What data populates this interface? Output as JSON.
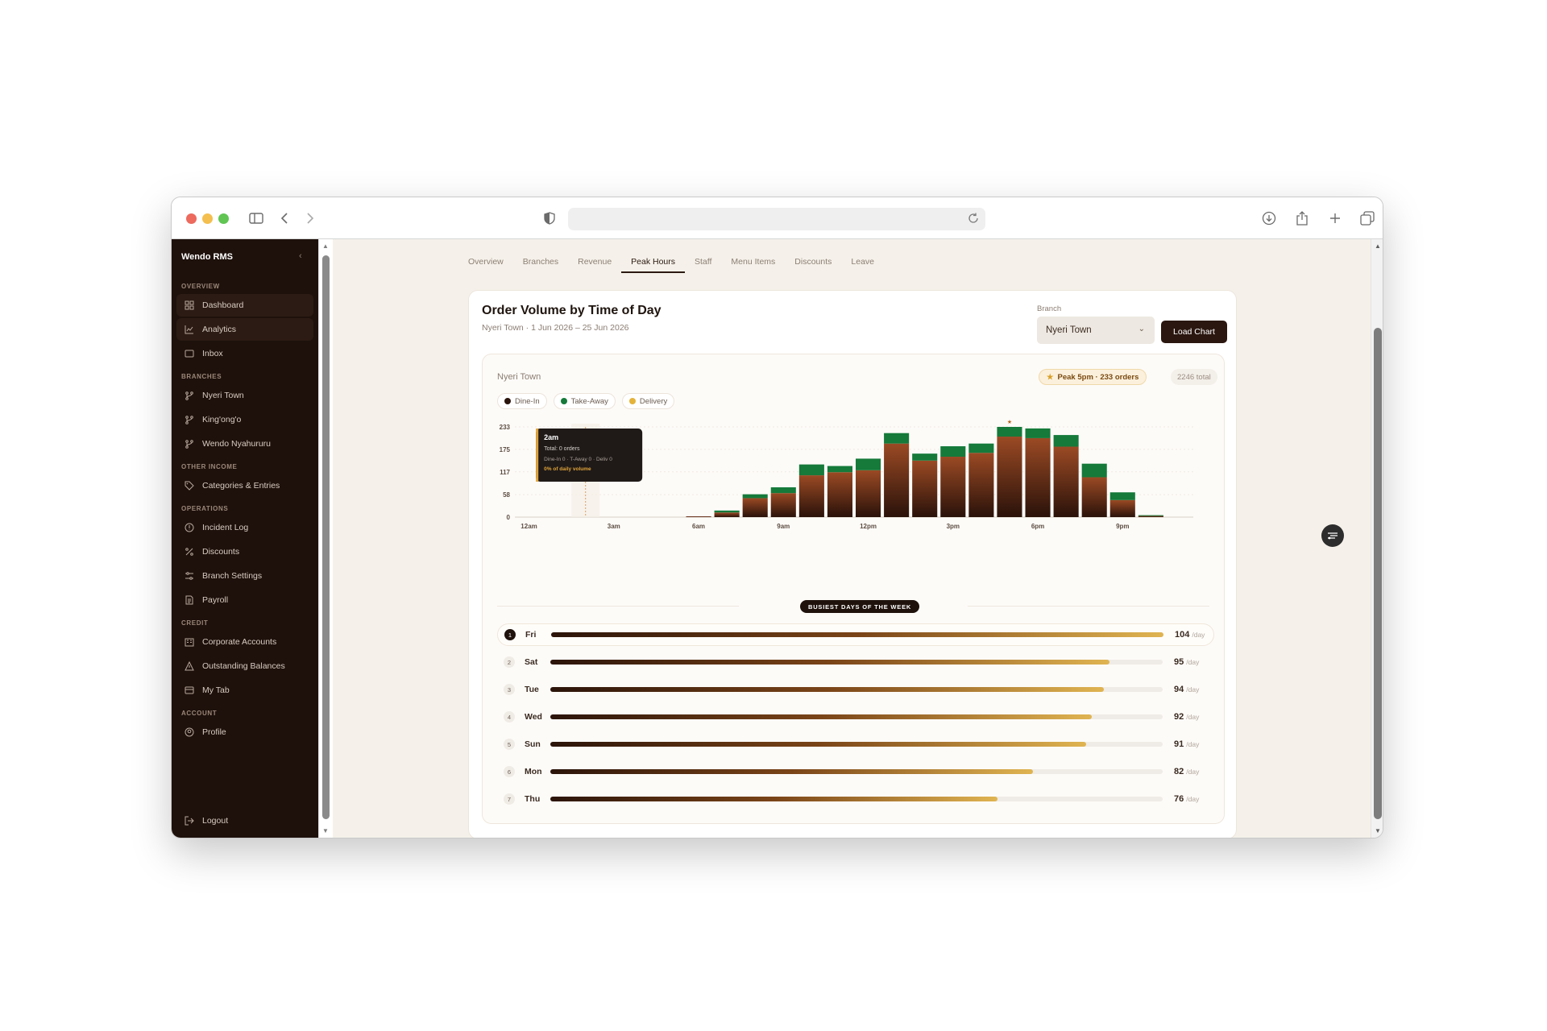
{
  "sidebar": {
    "brand": "Wendo RMS",
    "sections": [
      {
        "title": "OVERVIEW",
        "items": [
          {
            "label": "Dashboard",
            "icon": "grid-icon",
            "active": true
          },
          {
            "label": "Analytics",
            "icon": "chart-line-icon",
            "active": true
          },
          {
            "label": "Inbox",
            "icon": "inbox-icon",
            "active": false
          }
        ]
      },
      {
        "title": "BRANCHES",
        "items": [
          {
            "label": "Nyeri Town",
            "icon": "branch-icon"
          },
          {
            "label": "King'ong'o",
            "icon": "branch-icon"
          },
          {
            "label": "Wendo Nyahururu",
            "icon": "branch-icon"
          }
        ]
      },
      {
        "title": "OTHER INCOME",
        "items": [
          {
            "label": "Categories & Entries",
            "icon": "tag-icon"
          }
        ]
      },
      {
        "title": "OPERATIONS",
        "items": [
          {
            "label": "Incident Log",
            "icon": "alert-circle-icon"
          },
          {
            "label": "Discounts",
            "icon": "percent-icon"
          },
          {
            "label": "Branch Settings",
            "icon": "sliders-icon"
          },
          {
            "label": "Payroll",
            "icon": "document-icon"
          }
        ]
      },
      {
        "title": "CREDIT",
        "items": [
          {
            "label": "Corporate Accounts",
            "icon": "building-icon"
          },
          {
            "label": "Outstanding Balances",
            "icon": "warning-icon"
          },
          {
            "label": "My Tab",
            "icon": "card-icon"
          }
        ]
      },
      {
        "title": "ACCOUNT",
        "items": [
          {
            "label": "Profile",
            "icon": "user-circle-icon"
          }
        ]
      }
    ],
    "logout": "Logout"
  },
  "tabs": [
    {
      "label": "Overview",
      "active": false
    },
    {
      "label": "Branches",
      "active": false
    },
    {
      "label": "Revenue",
      "active": false
    },
    {
      "label": "Peak Hours",
      "active": true
    },
    {
      "label": "Staff",
      "active": false
    },
    {
      "label": "Menu Items",
      "active": false
    },
    {
      "label": "Discounts",
      "active": false
    },
    {
      "label": "Leave",
      "active": false
    }
  ],
  "card": {
    "title": "Order Volume by Time of Day",
    "subtitle": "Nyeri Town · 1 Jun 2026 – 25 Jun 2026",
    "branch_label": "Branch",
    "branch_value": "Nyeri Town",
    "load_button": "Load Chart",
    "panel_title": "Nyeri Town",
    "peak_badge": "Peak 5pm · 233 orders",
    "total_badge": "2246 total",
    "legend": [
      {
        "label": "Dine-In",
        "color": "#2a140b"
      },
      {
        "label": "Take-Away",
        "color": "#157a3a"
      },
      {
        "label": "Delivery",
        "color": "#e3b33a"
      }
    ],
    "busiest_title": "BUSIEST DAYS OF THE WEEK",
    "per_day_unit": "/day"
  },
  "tooltip": {
    "title": "2am",
    "total": "Total: 0 orders",
    "breakdown": "Dine-In 0 · T-Away 0 · Deliv 0",
    "share": "0% of daily volume"
  },
  "chart_data": {
    "type": "bar",
    "stacked": true,
    "x": [
      "12am",
      "1am",
      "2am",
      "3am",
      "4am",
      "5am",
      "6am",
      "7am",
      "8am",
      "9am",
      "10am",
      "11am",
      "12pm",
      "1pm",
      "2pm",
      "3pm",
      "4pm",
      "5pm",
      "6pm",
      "7pm",
      "8pm",
      "9pm",
      "10pm",
      "11pm"
    ],
    "x_tick_labels": [
      "12am",
      "3am",
      "6am",
      "9am",
      "12pm",
      "3pm",
      "6pm",
      "9pm"
    ],
    "y_ticks": [
      0,
      58,
      117,
      175,
      233
    ],
    "ylim": [
      0,
      233
    ],
    "peak_index": 17,
    "series": [
      {
        "name": "Dine-In",
        "color": "#7a3a1e",
        "values": [
          0,
          0,
          0,
          0,
          0,
          0,
          2,
          12,
          49,
          62,
          108,
          116,
          121,
          190,
          146,
          156,
          166,
          208,
          204,
          182,
          103,
          44,
          3,
          0
        ]
      },
      {
        "name": "Take-Away",
        "color": "#157a3a",
        "values": [
          0,
          0,
          0,
          0,
          0,
          0,
          0,
          5,
          10,
          15,
          28,
          16,
          30,
          27,
          18,
          27,
          24,
          25,
          25,
          30,
          35,
          20,
          2,
          0
        ]
      },
      {
        "name": "Delivery",
        "color": "#e3b33a",
        "values": [
          0,
          0,
          0,
          0,
          0,
          0,
          0,
          0,
          0,
          0,
          0,
          0,
          0,
          0,
          0,
          0,
          0,
          0,
          0,
          0,
          0,
          0,
          0,
          0
        ]
      }
    ]
  },
  "busiest_days": [
    {
      "rank": "1",
      "day": "Fri",
      "value": 104
    },
    {
      "rank": "2",
      "day": "Sat",
      "value": 95
    },
    {
      "rank": "3",
      "day": "Tue",
      "value": 94
    },
    {
      "rank": "4",
      "day": "Wed",
      "value": 92
    },
    {
      "rank": "5",
      "day": "Sun",
      "value": 91
    },
    {
      "rank": "6",
      "day": "Mon",
      "value": 82
    },
    {
      "rank": "7",
      "day": "Thu",
      "value": 76
    }
  ]
}
